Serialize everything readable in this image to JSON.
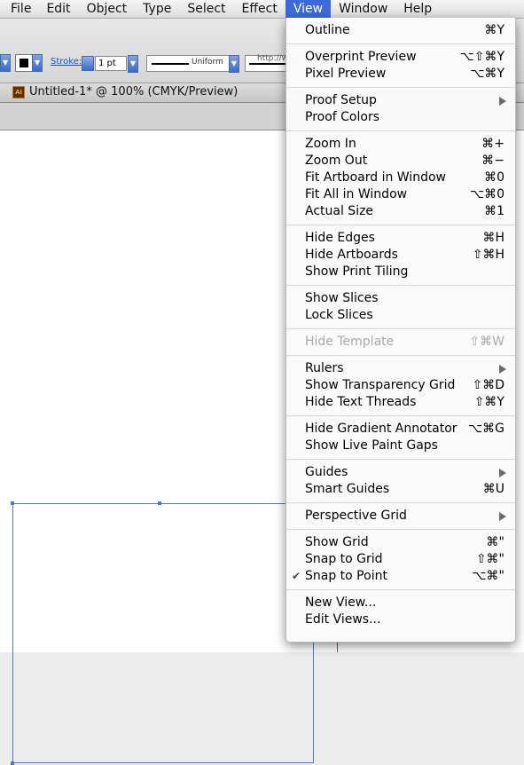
{
  "menubar": {
    "items": [
      "File",
      "Edit",
      "Object",
      "Type",
      "Select",
      "Effect",
      "View",
      "Window",
      "Help"
    ],
    "active": "View"
  },
  "controlbar": {
    "stroke_label": "Stroke:",
    "stroke_value": "1 pt",
    "profile": "Uniform",
    "url_partial": "http://www.adobe.com"
  },
  "document": {
    "title": "Untitled-1* @ 100% (CMYK/Preview)",
    "icon_text": "Ai"
  },
  "view_menu": {
    "groups": [
      [
        {
          "label": "Outline",
          "shortcut": "⌘Y"
        }
      ],
      [
        {
          "label": "Overprint Preview",
          "shortcut": "⌥⇧⌘Y"
        },
        {
          "label": "Pixel Preview",
          "shortcut": "⌥⌘Y"
        }
      ],
      [
        {
          "label": "Proof Setup",
          "submenu": true
        },
        {
          "label": "Proof Colors",
          "shortcut": ""
        }
      ],
      [
        {
          "label": "Zoom In",
          "shortcut": "⌘+"
        },
        {
          "label": "Zoom Out",
          "shortcut": "⌘−"
        },
        {
          "label": "Fit Artboard in Window",
          "shortcut": "⌘0"
        },
        {
          "label": "Fit All in Window",
          "shortcut": "⌥⌘0"
        },
        {
          "label": "Actual Size",
          "shortcut": "⌘1"
        }
      ],
      [
        {
          "label": "Hide Edges",
          "shortcut": "⌘H"
        },
        {
          "label": "Hide Artboards",
          "shortcut": "⇧⌘H"
        },
        {
          "label": "Show Print Tiling",
          "shortcut": ""
        }
      ],
      [
        {
          "label": "Show Slices",
          "shortcut": ""
        },
        {
          "label": "Lock Slices",
          "shortcut": ""
        }
      ],
      [
        {
          "label": "Hide Template",
          "shortcut": "⇧⌘W",
          "disabled": true
        }
      ],
      [
        {
          "label": "Rulers",
          "submenu": true
        },
        {
          "label": "Show Transparency Grid",
          "shortcut": "⇧⌘D"
        },
        {
          "label": "Hide Text Threads",
          "shortcut": "⇧⌘Y"
        }
      ],
      [
        {
          "label": "Hide Gradient Annotator",
          "shortcut": "⌥⌘G"
        },
        {
          "label": "Show Live Paint Gaps",
          "shortcut": ""
        }
      ],
      [
        {
          "label": "Guides",
          "submenu": true
        },
        {
          "label": "Smart Guides",
          "shortcut": "⌘U"
        }
      ],
      [
        {
          "label": "Perspective Grid",
          "submenu": true
        }
      ],
      [
        {
          "label": "Show Grid",
          "shortcut": "⌘\""
        },
        {
          "label": "Snap to Grid",
          "shortcut": "⇧⌘\""
        },
        {
          "label": "Snap to Point",
          "shortcut": "⌥⌘\"",
          "checked": true
        }
      ],
      [
        {
          "label": "New View...",
          "shortcut": ""
        },
        {
          "label": "Edit Views...",
          "shortcut": ""
        }
      ]
    ]
  },
  "icons": {
    "check": "✔",
    "submenu": "submenu-arrow-icon",
    "dropdown": "chevron-down-icon"
  }
}
